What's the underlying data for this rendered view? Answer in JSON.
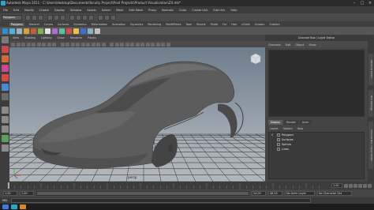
{
  "window": {
    "title": "Autodesk Maya 2011 - C:\\Users\\desktop\\Documents\\faculty Project\\Prod Projects\\Product Visualization\\Z4.mb*",
    "minimize": "–",
    "maximize": "□",
    "close": "×"
  },
  "menubar": [
    "File",
    "Edit",
    "Modify",
    "Create",
    "Display",
    "Window",
    "Assets",
    "Select",
    "Mesh",
    "Edit Mesh",
    "Proxy",
    "Normals",
    "Color",
    "Create UVs",
    "Edit UVs",
    "Help"
  ],
  "statusline": {
    "mode": "Polygons"
  },
  "shelf": {
    "tabs": [
      "Polygons",
      "General",
      "Curves",
      "Surfaces",
      "Dynamics",
      "Deformation",
      "Animation",
      "Dynamics",
      "Rendering",
      "PaintEffects",
      "Toon",
      "Muscle",
      "Fluids",
      "Fur",
      "Hair",
      "nCloth",
      "Custom",
      "Subdivs"
    ],
    "active_tab": "Polygons",
    "icon_colors": [
      "#2f8fce",
      "#4fb0e0",
      "#9fb4c2",
      "#d8a23b",
      "#c65b3a",
      "#7fb04a",
      "#e0e0e0",
      "#a86fcc",
      "#5fc0a0",
      "#d64a4a",
      "#e6c34a",
      "#3b6fd0",
      "#8ab0c8",
      "#c0c0c0"
    ]
  },
  "viewport": {
    "menu": [
      "View",
      "Shading",
      "Lighting",
      "Show",
      "Renderer",
      "Panels"
    ],
    "camera_label": "persp",
    "background_top": "#6f7e8c",
    "background_bottom": "#b2b7bb",
    "grid_color": "#2a2a2a",
    "model_color": "#5c5c5c"
  },
  "channel_box": {
    "title": "Channel Box / Layer Editor",
    "menu": [
      "Channels",
      "Edit",
      "Object",
      "Show"
    ],
    "layer_tabs": [
      "Display",
      "Render",
      "Anim"
    ],
    "active_layer_tab": "Display",
    "layer_menu": [
      "Layers",
      "Options",
      "Help"
    ],
    "layers": [
      {
        "v": "V",
        "name": "Polygons"
      },
      {
        "v": "",
        "name": "Surfaces"
      },
      {
        "v": "",
        "name": "Splines"
      },
      {
        "v": "",
        "name": "Lines"
      }
    ]
  },
  "side_tabs": [
    "Attribute Editor",
    "Tool Settings",
    "Channel Box / Layer Editor"
  ],
  "time": {
    "start": "1.00",
    "inner_start": "1.00",
    "inner_end": "24.00",
    "end": "48.00",
    "anim_layer": "No Anim Layer",
    "character": "No Character Set",
    "current_frame": "1.00"
  },
  "command_line": {
    "label": "MEL"
  },
  "help_line": {
    "text": ""
  },
  "accent": "#2aa6c9"
}
